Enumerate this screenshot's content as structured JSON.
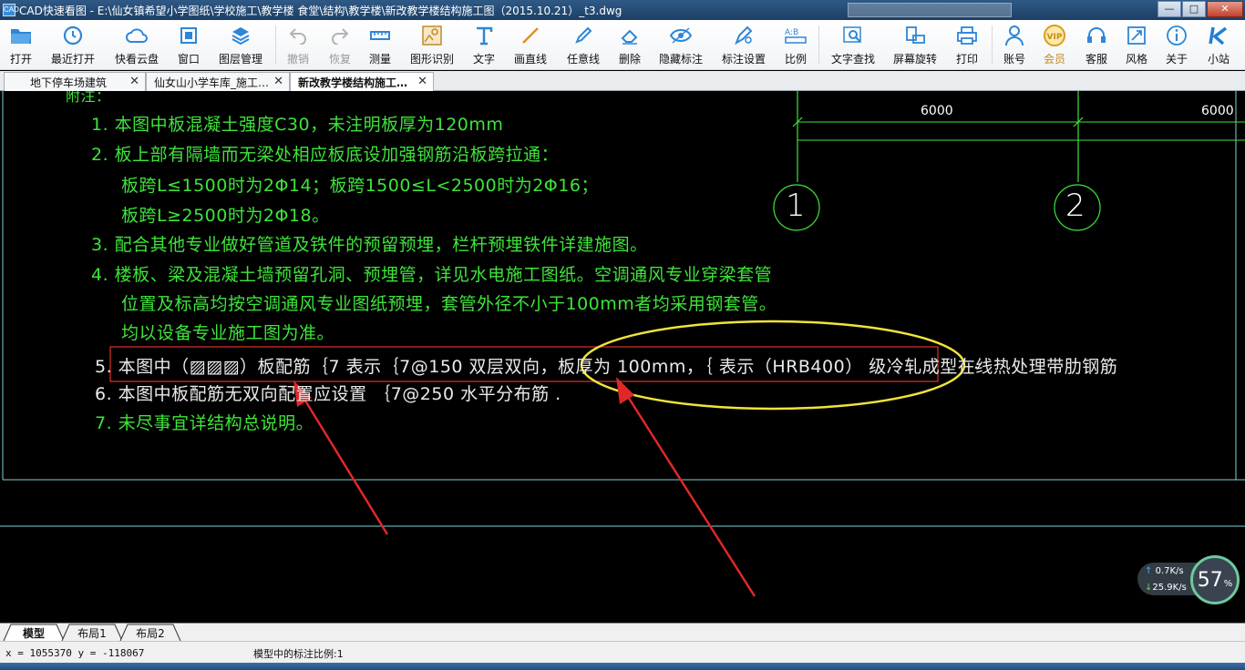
{
  "window": {
    "title": "CAD快速看图 - E:\\仙女镇希望小学图纸\\学校施工\\教学楼 食堂\\结构\\教学楼\\新改教学楼结构施工图（2015.10.21）_t3.dwg",
    "app_icon_text": "CAD",
    "minimize": "—",
    "maximize": "□",
    "close": "✕"
  },
  "toolbar": {
    "items": [
      {
        "label": "打开",
        "icon": "folder-icon"
      },
      {
        "label": "最近打开",
        "icon": "clock-icon"
      },
      {
        "label": "快看云盘",
        "icon": "cloud-icon"
      },
      {
        "label": "窗口",
        "icon": "window-icon"
      },
      {
        "label": "图层管理",
        "icon": "layers-icon"
      },
      {
        "label": "撤销",
        "icon": "undo-icon"
      },
      {
        "label": "恢复",
        "icon": "redo-icon"
      },
      {
        "label": "测量",
        "icon": "ruler-icon"
      },
      {
        "label": "图形识别",
        "icon": "shape-recognition-icon"
      },
      {
        "label": "文字",
        "icon": "text-icon"
      },
      {
        "label": "画直线",
        "icon": "line-icon"
      },
      {
        "label": "任意线",
        "icon": "pen-icon"
      },
      {
        "label": "删除",
        "icon": "eraser-icon"
      },
      {
        "label": "隐藏标注",
        "icon": "eye-icon"
      },
      {
        "label": "标注设置",
        "icon": "annotation-settings-icon"
      },
      {
        "label": "比例",
        "icon": "scale-icon"
      },
      {
        "label": "文字查找",
        "icon": "text-search-icon"
      },
      {
        "label": "屏幕旋转",
        "icon": "rotate-screen-icon"
      },
      {
        "label": "打印",
        "icon": "printer-icon"
      },
      {
        "label": "账号",
        "icon": "user-icon"
      },
      {
        "label": "会员",
        "icon": "vip-icon"
      },
      {
        "label": "客服",
        "icon": "headset-icon"
      },
      {
        "label": "风格",
        "icon": "style-icon"
      },
      {
        "label": "关于",
        "icon": "info-icon"
      },
      {
        "label": "小站",
        "icon": "k-logo-icon"
      }
    ],
    "vip_badge": "VIP",
    "scale_glyph": "A:B"
  },
  "tabs": [
    {
      "label": "地下停车场建筑"
    },
    {
      "label": "仙女山小学车库_施工…"
    },
    {
      "label": "新改教学楼结构施工…"
    }
  ],
  "tab_close": "✕",
  "drawing": {
    "heading_fragment": "附注：",
    "notes": [
      "1. 本图中板混凝土强度C30，未注明板厚为120mm",
      "2. 板上部有隔墙而无梁处相应板底设加强钢筋沿板跨拉通：",
      "板跨L≤1500时为2Φ14；板跨1500≤L<2500时为2Φ16；",
      "板跨L≥2500时为2Φ18。",
      "3. 配合其他专业做好管道及铁件的预留预埋，栏杆预埋铁件详建施图。",
      "4. 楼板、梁及混凝土墙预留孔洞、预埋管，详见水电施工图纸。空调通风专业穿梁套管",
      "位置及标高均按空调通风专业图纸预埋，套管外径不小于100mm者均采用钢套管。",
      "均以设备专业施工图为准。",
      "5. 本图中（▨▨▨）板配筋｛7 表示｛7@150  双层双向，板厚为      100mm，｛      表示（HRB400）  级冷轧成型在线热处理带肋钢筋",
      "6. 本图中板配筋无双向配置应设置       ｛7@250  水平分布筋   .",
      "7. 未尽事宜详结构总说明。"
    ],
    "trailing_dot": ".",
    "dimensions": [
      "6000",
      "6000"
    ],
    "axes": [
      "1",
      "2"
    ]
  },
  "network": {
    "up": "0.7",
    "down": "25.9",
    "unit": "K/s",
    "up_arrow": "↑",
    "down_arrow": "↓",
    "percent": "57",
    "percent_sign": "%"
  },
  "layouts": [
    {
      "label": "模型"
    },
    {
      "label": "布局1"
    },
    {
      "label": "布局2"
    }
  ],
  "status": {
    "coords": "x = 1055370  y = -118067",
    "scale_text": "模型中的标注比例:1"
  },
  "colors": {
    "cad_green": "#3ee43a",
    "annotation_red": "#e03030",
    "annotation_yellow": "#f1e33b",
    "border_cyan": "#7fd3d3"
  }
}
